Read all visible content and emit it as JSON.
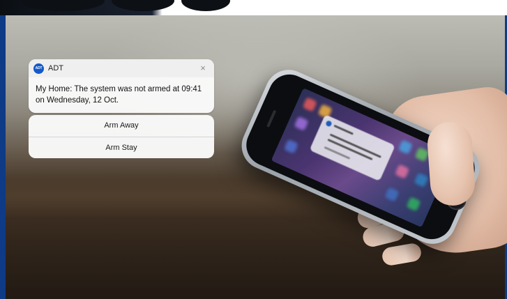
{
  "notification": {
    "app_icon_text": "ADT",
    "app_name": "ADT",
    "close_symbol": "×",
    "message": "My Home: The system was not armed at 09:41 on Wednesday, 12 Oct."
  },
  "actions": [
    {
      "label": "Arm Away"
    },
    {
      "label": "Arm Stay"
    }
  ],
  "colors": {
    "brand_blue": "#1459c7",
    "frame_blue": "#0f3a86"
  },
  "icons": {
    "app": "adt-logo-icon",
    "close": "close-icon"
  }
}
